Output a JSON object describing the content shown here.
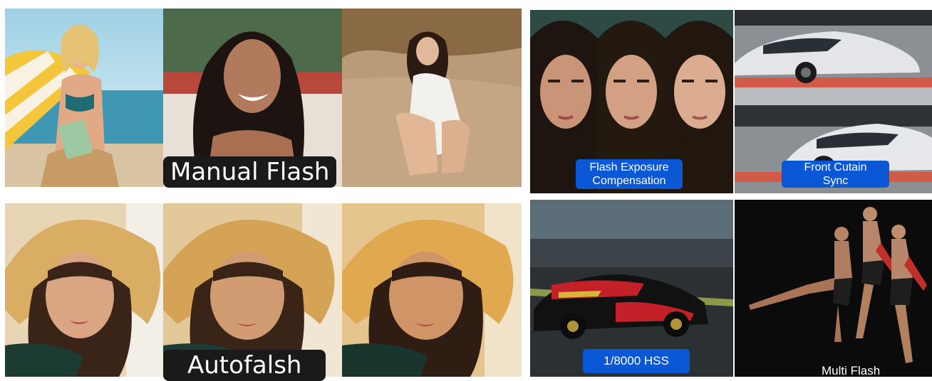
{
  "labels": {
    "manual_flash": "Manual Flash",
    "autoflash": "Autofalsh",
    "flash_exposure_line1": "Flash Exposure",
    "flash_exposure_line2": "Compensation",
    "front_curtain_line1": "Front Cutain",
    "front_curtain_line2": "Sync",
    "hss": "1/8000 HSS",
    "multi_flash": "Multi Flash"
  },
  "colors": {
    "badge_dark": "#1a1a1a",
    "badge_blue": "#0a58d6"
  }
}
